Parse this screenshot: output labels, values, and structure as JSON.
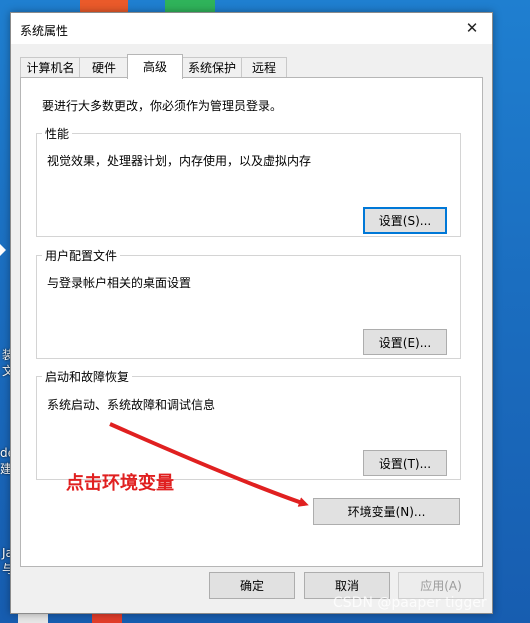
{
  "window": {
    "title": "系统属性",
    "close_glyph": "✕"
  },
  "tabs": [
    {
      "label": "计算机名"
    },
    {
      "label": "硬件"
    },
    {
      "label": "高级",
      "active": true
    },
    {
      "label": "系统保护"
    },
    {
      "label": "远程"
    }
  ],
  "intro": "要进行大多数更改，你必须作为管理员登录。",
  "groups": {
    "performance": {
      "title": "性能",
      "description": "视觉效果，处理器计划，内存使用，以及虚拟内存",
      "button": "设置(S)..."
    },
    "user_profiles": {
      "title": "用户配置文件",
      "description": "与登录帐户相关的桌面设置",
      "button": "设置(E)..."
    },
    "startup_recovery": {
      "title": "启动和故障恢复",
      "description": "系统启动、系统故障和调试信息",
      "button": "设置(T)..."
    }
  },
  "env_button": "环境变量(N)...",
  "footer": {
    "ok": "确定",
    "cancel": "取消",
    "apply": "应用(A)"
  },
  "annotation": {
    "text": "点击环境变量",
    "color": "#e02020"
  },
  "desktop_text": [
    "装",
    "文",
    "de",
    "建",
    "Ja",
    "与"
  ],
  "watermark": "CSDN @paaper tigger",
  "colors": {
    "accent": "#0078d7",
    "desktop": "#1b6ec0"
  }
}
